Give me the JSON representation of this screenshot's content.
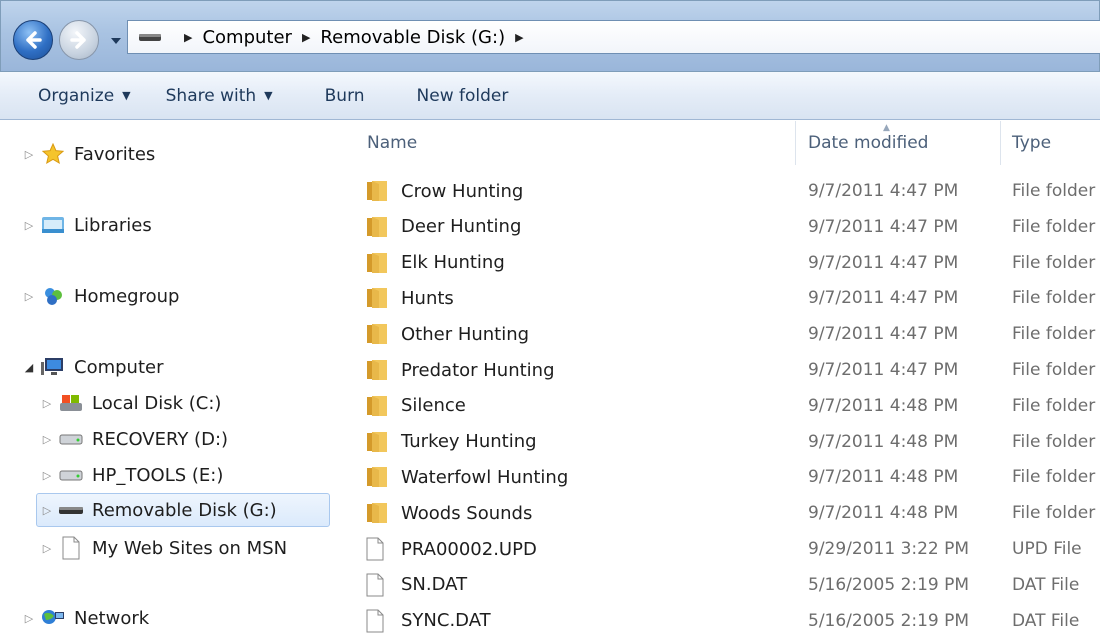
{
  "address": {
    "crumbs": [
      "Computer",
      "Removable Disk (G:)"
    ]
  },
  "toolbar": {
    "organize": "Organize",
    "share_with": "Share with",
    "burn": "Burn",
    "new_folder": "New folder"
  },
  "nav": {
    "favorites": "Favorites",
    "libraries": "Libraries",
    "homegroup": "Homegroup",
    "computer": "Computer",
    "local_disk": "Local Disk (C:)",
    "recovery": "RECOVERY (D:)",
    "hp_tools": "HP_TOOLS (E:)",
    "removable": "Removable Disk (G:)",
    "my_web_sites": "My Web Sites on MSN",
    "network": "Network"
  },
  "columns": {
    "name": "Name",
    "date_modified": "Date modified",
    "type": "Type"
  },
  "files": [
    {
      "name": "Crow Hunting",
      "date": "9/7/2011 4:47 PM",
      "type": "File folder",
      "kind": "folder"
    },
    {
      "name": "Deer Hunting",
      "date": "9/7/2011 4:47 PM",
      "type": "File folder",
      "kind": "folder"
    },
    {
      "name": "Elk Hunting",
      "date": "9/7/2011 4:47 PM",
      "type": "File folder",
      "kind": "folder"
    },
    {
      "name": "Hunts",
      "date": "9/7/2011 4:47 PM",
      "type": "File folder",
      "kind": "folder"
    },
    {
      "name": "Other Hunting",
      "date": "9/7/2011 4:47 PM",
      "type": "File folder",
      "kind": "folder"
    },
    {
      "name": "Predator Hunting",
      "date": "9/7/2011 4:47 PM",
      "type": "File folder",
      "kind": "folder"
    },
    {
      "name": "Silence",
      "date": "9/7/2011 4:48 PM",
      "type": "File folder",
      "kind": "folder"
    },
    {
      "name": "Turkey Hunting",
      "date": "9/7/2011 4:48 PM",
      "type": "File folder",
      "kind": "folder"
    },
    {
      "name": "Waterfowl Hunting",
      "date": "9/7/2011 4:48 PM",
      "type": "File folder",
      "kind": "folder"
    },
    {
      "name": "Woods Sounds",
      "date": "9/7/2011 4:48 PM",
      "type": "File folder",
      "kind": "folder"
    },
    {
      "name": "PRA00002.UPD",
      "date": "9/29/2011 3:22 PM",
      "type": "UPD File",
      "kind": "file"
    },
    {
      "name": "SN.DAT",
      "date": "5/16/2005 2:19 PM",
      "type": "DAT File",
      "kind": "file"
    },
    {
      "name": "SYNC.DAT",
      "date": "5/16/2005 2:19 PM",
      "type": "DAT File",
      "kind": "file"
    }
  ],
  "colors": {
    "folder": "#e8b84a",
    "selection": "#dbeafc",
    "accent": "#1e395b"
  }
}
